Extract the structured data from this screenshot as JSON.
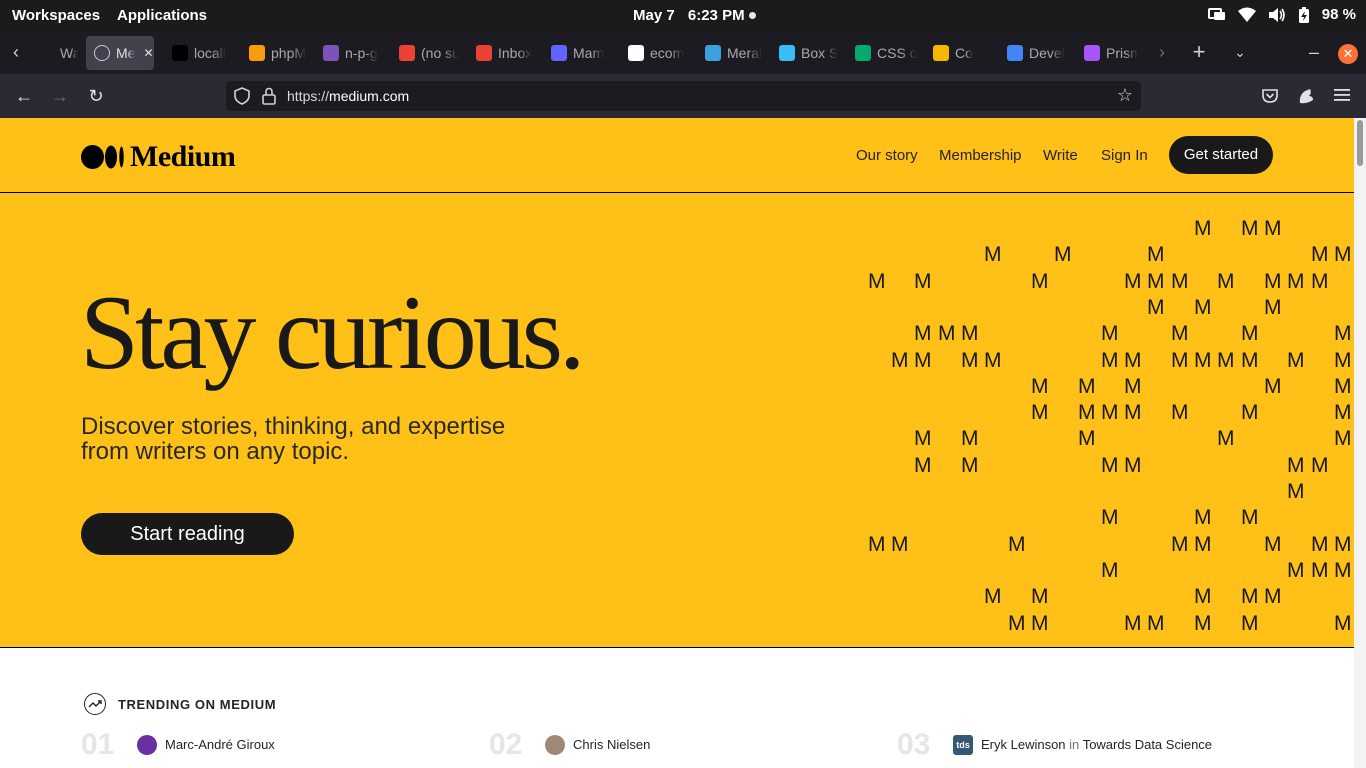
{
  "os": {
    "workspaces": "Workspaces",
    "applications": "Applications",
    "date": "May 7",
    "time": "6:23 PM",
    "battery": "98 %"
  },
  "tabs": [
    {
      "label": "Walle",
      "icon": "wallet-icon",
      "color": "#1c1b22"
    },
    {
      "label": "Me",
      "icon": "globe-icon",
      "color": "#42414d",
      "active": true
    },
    {
      "label": "locall",
      "icon": "triangle-icon",
      "color": "#000000"
    },
    {
      "label": "phpM",
      "icon": "phpmyadmin-icon",
      "color": "#f89c0e"
    },
    {
      "label": "n-p-g",
      "icon": "letter-h-icon",
      "color": "#7f52b8"
    },
    {
      "label": "(no su",
      "icon": "gmail-icon",
      "color": "#ea4335"
    },
    {
      "label": "Inbox",
      "icon": "gmail-icon",
      "color": "#ea4335"
    },
    {
      "label": "Mam",
      "icon": "mastodon-icon",
      "color": "#6364ff"
    },
    {
      "label": "ecom",
      "icon": "github-icon",
      "color": "#ffffff"
    },
    {
      "label": "Meral",
      "icon": "bird-icon",
      "color": "#3aa0e0"
    },
    {
      "label": "Box S",
      "icon": "tailwind-icon",
      "color": "#38bdf8"
    },
    {
      "label": "CSS o",
      "icon": "w3-icon",
      "color": "#04aa6d"
    },
    {
      "label": "Co",
      "icon": "emoji-icon",
      "color": "#f5b800"
    },
    {
      "label": "Devel",
      "icon": "doc-icon",
      "color": "#4285f4"
    },
    {
      "label": "Prism",
      "icon": "prism-icon",
      "color": "#a855f7"
    }
  ],
  "browser": {
    "url_scheme": "https://",
    "url_host": "medium.com"
  },
  "site": {
    "brand": "Medium",
    "nav": {
      "our_story": "Our story",
      "membership": "Membership",
      "write": "Write",
      "sign_in": "Sign In",
      "get_started": "Get started"
    },
    "hero": {
      "title": "Stay curious.",
      "subtitle": "Discover stories, thinking, and expertise from writers on any topic.",
      "cta": "Start reading"
    },
    "hero_glyph": "M",
    "trending": {
      "label": "TRENDING ON MEDIUM",
      "items": [
        {
          "number": "01",
          "author": "Marc-André Giroux",
          "publication": ""
        },
        {
          "number": "02",
          "author": "Chris Nielsen",
          "publication": ""
        },
        {
          "number": "03",
          "author": "Eryk Lewinson",
          "in": "in",
          "publication": "Towards Data Science"
        }
      ]
    }
  },
  "colors": {
    "brand_yellow": "#ffc017",
    "dark": "#191919"
  }
}
